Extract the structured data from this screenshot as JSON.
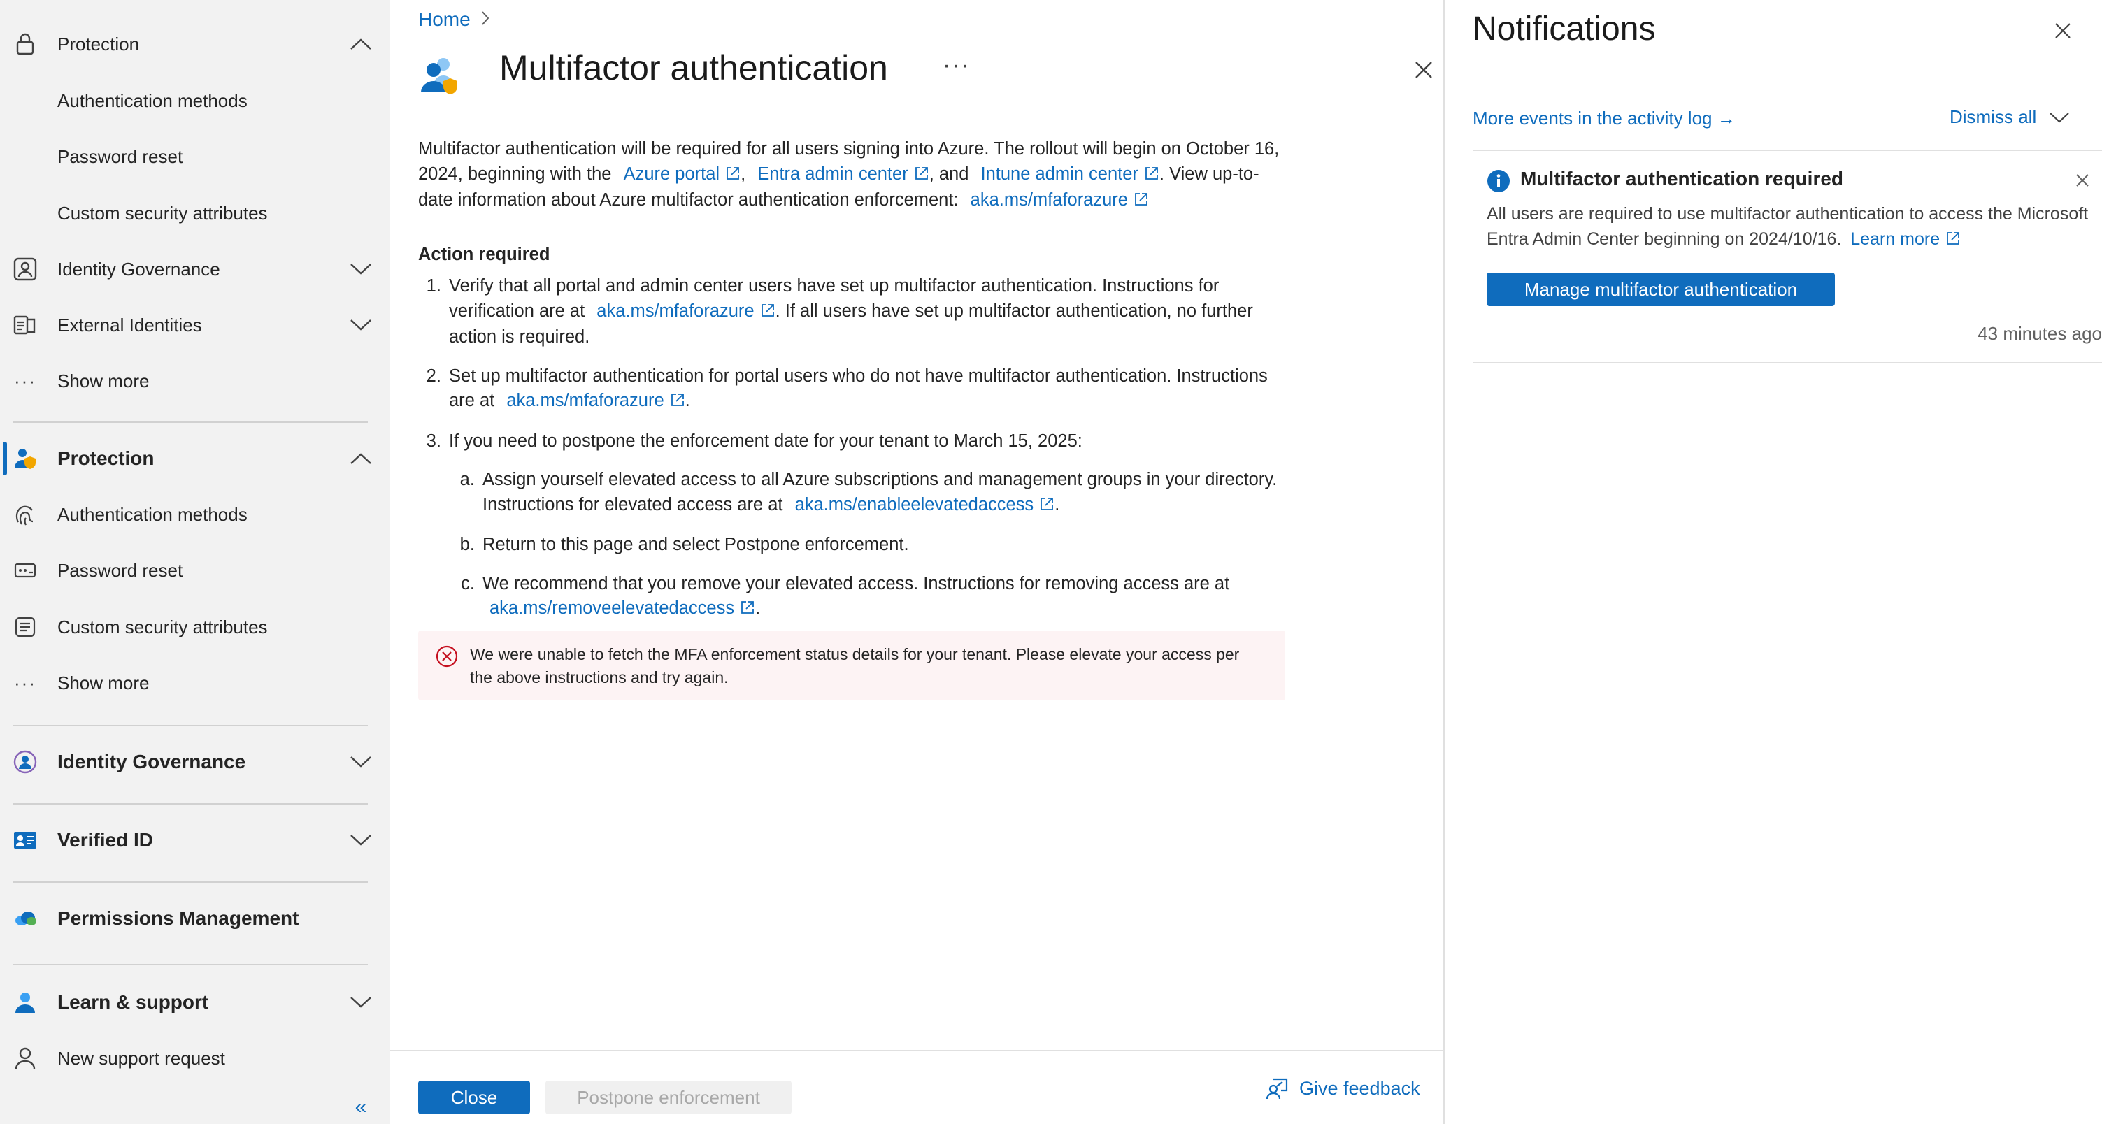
{
  "sidebar": {
    "items": [
      {
        "label": "Protection",
        "icon": "lock-icon",
        "chevron": "up"
      },
      {
        "label": "Authentication methods"
      },
      {
        "label": "Password reset"
      },
      {
        "label": "Custom security attributes"
      },
      {
        "label": "Identity Governance",
        "icon": "governance-icon",
        "chevron": "down"
      },
      {
        "label": "External Identities",
        "icon": "external-identities-icon",
        "chevron": "down"
      },
      {
        "label": "Show more",
        "icon": "more-icon"
      },
      {
        "label": "Protection",
        "icon": "protection-icon",
        "chevron": "up",
        "active": true
      },
      {
        "label": "Authentication methods",
        "icon": "fingerprint-icon"
      },
      {
        "label": "Password reset",
        "icon": "password-icon"
      },
      {
        "label": "Custom security attributes",
        "icon": "attributes-icon"
      },
      {
        "label": "Show more",
        "icon": "more-icon"
      },
      {
        "label": "Identity Governance",
        "icon": "identity-governance-icon",
        "chevron": "down"
      },
      {
        "label": "Verified ID",
        "icon": "verified-id-icon",
        "chevron": "down"
      },
      {
        "label": "Permissions Management",
        "icon": "permissions-cloud-icon"
      },
      {
        "label": "Learn & support",
        "icon": "support-person-icon",
        "chevron": "down"
      },
      {
        "label": "New support request",
        "icon": "person-icon"
      }
    ],
    "collapse_label": "«"
  },
  "breadcrumb": {
    "home": "Home"
  },
  "blade": {
    "title": "Multifactor authentication",
    "more": "···",
    "intro": {
      "p1": "Multifactor authentication will be required for all users signing into Azure. The rollout will begin on October 16, 2024, beginning with the",
      "link1": "Azure portal",
      "sep1": ",",
      "link2": "Entra admin center",
      "sep2": ", and",
      "link3": "Intune admin center",
      "p2": ". View up-to-date information about Azure multifactor authentication enforcement:",
      "link4": "aka.ms/mfaforazure"
    },
    "action_title": "Action required",
    "steps": {
      "s1_a": "Verify that all portal and admin center users have set up multifactor authentication. Instructions for verification are at",
      "s1_link": "aka.ms/mfaforazure",
      "s1_b": ". If all users have set up multifactor authentication, no further action is required.",
      "s2_a": "Set up multifactor authentication for portal users who do not have multifactor authentication. Instructions are at",
      "s2_link": "aka.ms/mfaforazure",
      "s2_b": ".",
      "s3": "If you need to postpone the enforcement date for your tenant to March 15, 2025:",
      "sa_a": "Assign yourself elevated access to all Azure subscriptions and management groups in your directory. Instructions for elevated access are at",
      "sa_link": "aka.ms/enableelevatedaccess",
      "sa_b": ".",
      "sb": "Return to this page and select Postpone enforcement.",
      "sc_a": "We recommend that you remove your elevated access. Instructions for removing access are at",
      "sc_link": "aka.ms/removeelevatedaccess",
      "sc_b": "."
    },
    "error": "We were unable to fetch the MFA enforcement status details for your tenant. Please elevate your access per the above instructions and try again.",
    "footer": {
      "close": "Close",
      "postpone": "Postpone enforcement",
      "feedback": "Give feedback"
    }
  },
  "notifications": {
    "title": "Notifications",
    "activity_link": "More events in the activity log →",
    "dismiss_all": "Dismiss all",
    "card": {
      "title": "Multifactor authentication required",
      "body": "All users are required to use multifactor authentication to access the Microsoft Entra Admin Center beginning on 2024/10/16.",
      "learn_more": "Learn more",
      "button": "Manage multifactor authentication",
      "time": "43 minutes ago"
    }
  },
  "colors": {
    "accent": "#0f6cbd",
    "sidebar_bg": "#f2f2f2",
    "error_bg": "#fdf3f4",
    "error_icon": "#c50f1f"
  }
}
